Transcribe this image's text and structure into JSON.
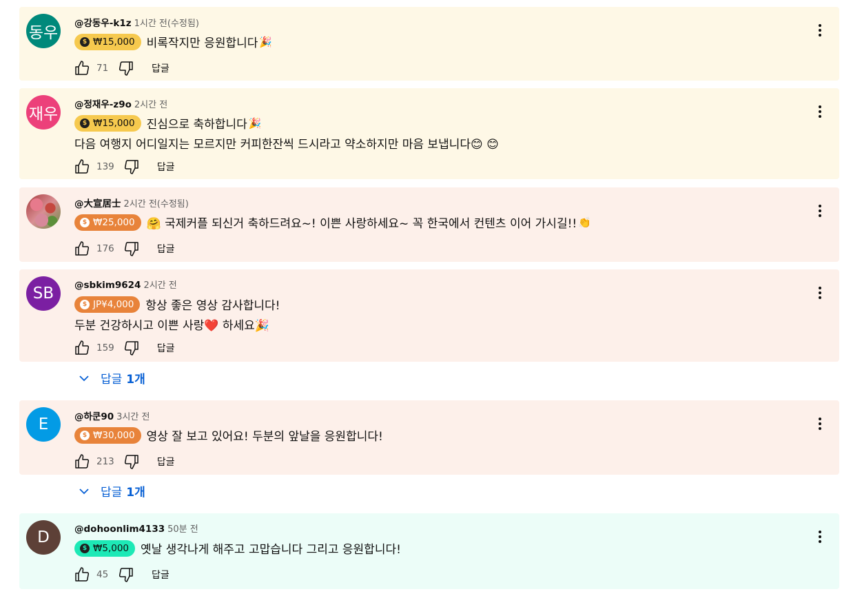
{
  "comments": [
    {
      "avatar_text": "동우",
      "avatar_color": "#00897b",
      "author": "@강동우-k1z",
      "time": "1시간 전(수정됨)",
      "chip": "₩15,000",
      "chip_color": "#f6c94e",
      "text1": "비록작지만 응원합니다",
      "emoji1": "🎉",
      "text2": "",
      "likes": "71",
      "reply_label": "답글",
      "bg": "#fef8e6"
    },
    {
      "avatar_text": "재우",
      "avatar_color": "#ec407a",
      "author": "@정재우-z9o",
      "time": "2시간 전",
      "chip": "₩15,000",
      "chip_color": "#f6c94e",
      "text1": "진심으로 축하합니다",
      "emoji1": "🎉",
      "text2": "다음 여행지 어디일지는 모르지만 커피한잔씩 드시라고 약소하지만 마음 보냅니다😊 😊",
      "likes": "139",
      "reply_label": "답글",
      "bg": "#fef8e6"
    },
    {
      "avatar_text": "",
      "avatar_color": "#c86b6b",
      "author": "@大宣居士",
      "time": "2시간 전(수정됨)",
      "chip": "₩25,000",
      "chip_color": "#e8833a",
      "text1": "🤗 국제커플 되신거 축하드려요~! 이쁜 사랑하세요~ 꼭 한국에서 컨텐츠 이어 가시길!!",
      "emoji1": "👏",
      "text2": "",
      "likes": "176",
      "reply_label": "답글",
      "bg": "#fdf0ea"
    },
    {
      "avatar_text": "SB",
      "avatar_color": "#7b1fa2",
      "author": "@sbkim9624",
      "time": "2시간 전",
      "chip": "JP¥4,000",
      "chip_color": "#e8833a",
      "text1": "항상 좋은 영상 감사합니다!",
      "emoji1": "",
      "text2": "두분 건강하시고 이쁜 사랑❤️ 하세요🎉",
      "likes": "159",
      "reply_label": "답글",
      "bg": "#fdf0ea"
    },
    {
      "avatar_text": "E",
      "avatar_color": "#039be5",
      "author": "@하쿤90",
      "time": "3시간 전",
      "chip": "₩30,000",
      "chip_color": "#e8833a",
      "text1": "영상 잘 보고 있어요!  두분의 앞날을 응원합니다!",
      "emoji1": "",
      "text2": "",
      "likes": "213",
      "reply_label": "답글",
      "bg": "#fdf0ea"
    },
    {
      "avatar_text": "D",
      "avatar_color": "#5d4037",
      "author": "@dohoonlim4133",
      "time": "50분 전",
      "chip": "₩5,000",
      "chip_color": "#1de9b6",
      "text1": "옛날 생각나게 해주고 고맙습니다 그리고 응원합니다!",
      "emoji1": "",
      "text2": "",
      "likes": "45",
      "reply_label": "답글",
      "bg": "#ecfdf8"
    }
  ],
  "replies_toggles": [
    {
      "prefix": "답글",
      "count": "1개"
    },
    {
      "prefix": "답글",
      "count": "1개"
    }
  ]
}
